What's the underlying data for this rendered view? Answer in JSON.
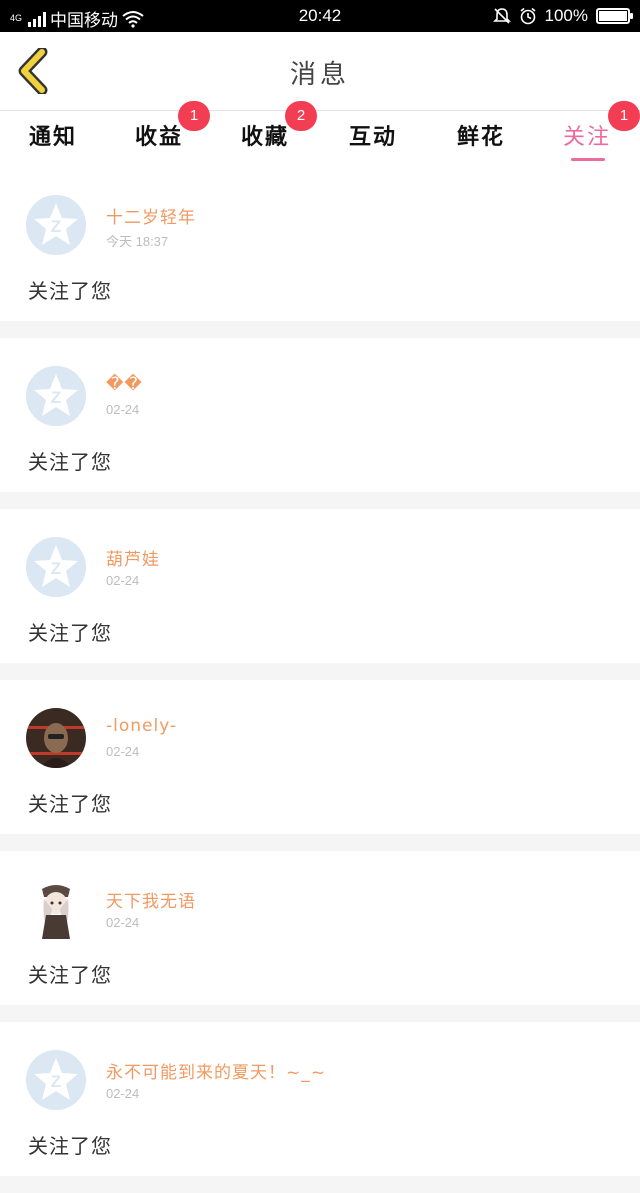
{
  "status_bar": {
    "network": "4G",
    "carrier": "中国移动",
    "time": "20:42",
    "battery": "100%",
    "battery_level": 1.0
  },
  "header": {
    "title": "消息"
  },
  "tabs": [
    {
      "label": "通知",
      "badge": ""
    },
    {
      "label": "收益",
      "badge": "1"
    },
    {
      "label": "收藏",
      "badge": "2"
    },
    {
      "label": "互动",
      "badge": ""
    },
    {
      "label": "鲜花",
      "badge": ""
    },
    {
      "label": "关注",
      "badge": "1"
    }
  ],
  "active_tab": "关注",
  "colors": {
    "accent_pink": "#ec6b9d",
    "badge_red": "#f23d52",
    "name_orange": "#f09a62",
    "back_yellow": "#f1d23c"
  },
  "messages": [
    {
      "name": "十二岁轻年",
      "time": "今天 18:37",
      "text": "关注了您",
      "avatar": "default-qzone-avatar"
    },
    {
      "name": "��",
      "time": "02-24",
      "text": "关注了您",
      "avatar": "default-qzone-avatar"
    },
    {
      "name": "葫芦娃",
      "time": "02-24",
      "text": "关注了您",
      "avatar": "default-qzone-avatar"
    },
    {
      "name": "-lonely-",
      "time": "02-24",
      "text": "关注了您",
      "avatar": "photo-avatar-person"
    },
    {
      "name": "天下我无语",
      "time": "02-24",
      "text": "关注了您",
      "avatar": "anime-girl-avatar"
    },
    {
      "name": "永不可能到来的夏天！~_~",
      "time": "02-24",
      "text": "关注了您",
      "avatar": "default-qzone-avatar"
    }
  ]
}
